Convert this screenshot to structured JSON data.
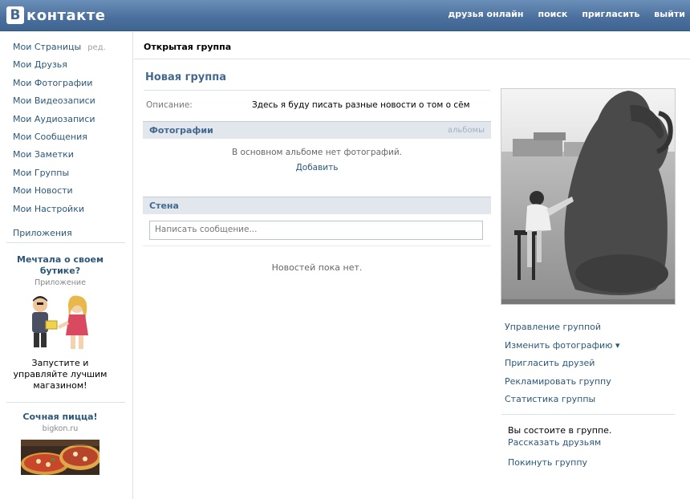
{
  "header": {
    "logo_letter": "В",
    "logo_text": "контакте",
    "nav": [
      "друзья онлайн",
      "поиск",
      "пригласить",
      "выйти"
    ]
  },
  "sidebar": {
    "items": [
      {
        "label": "Мои Страницы",
        "extra": "ред."
      },
      {
        "label": "Мои Друзья"
      },
      {
        "label": "Мои Фотографии"
      },
      {
        "label": "Мои Видеозаписи"
      },
      {
        "label": "Мои Аудиозаписи"
      },
      {
        "label": "Мои Сообщения"
      },
      {
        "label": "Мои Заметки"
      },
      {
        "label": "Мои Группы"
      },
      {
        "label": "Мои Новости"
      },
      {
        "label": "Мои Настройки"
      }
    ],
    "apps": "Приложения"
  },
  "ads": [
    {
      "title": "Мечтала о своем бутике?",
      "domain": "Приложение",
      "text": "Запустите и управляйте лучшим магазином!"
    },
    {
      "title": "Сочная пицца!",
      "domain": "bigkon.ru"
    }
  ],
  "breadcrumb": "Открытая группа",
  "group": {
    "name": "Новая группа",
    "description_label": "Описание:",
    "description": "Здесь я буду писать разные новости о том о сём"
  },
  "photos": {
    "title": "Фотографии",
    "albums": "альбомы",
    "empty": "В основном альбоме нет фотографий.",
    "add": "Добавить"
  },
  "wall": {
    "title": "Стена",
    "placeholder": "Написать сообщение...",
    "empty": "Новостей пока нет."
  },
  "actions": [
    "Управление группой",
    "Изменить фотографию ▾",
    "Пригласить друзей",
    "Рекламировать группу",
    "Статистика группы"
  ],
  "membership": {
    "status": "Вы состоите в группе.",
    "tell_friends": "Рассказать друзьям",
    "leave": "Покинуть группу"
  },
  "colors": {
    "header": "#4a6f9c",
    "link": "#2b587a",
    "section_bg": "#e1e7ed"
  }
}
